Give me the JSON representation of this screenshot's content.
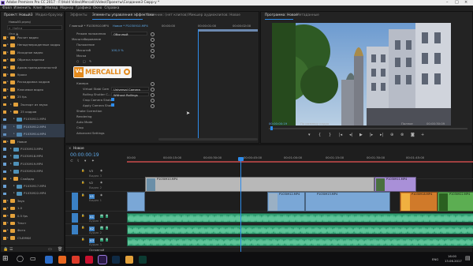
{
  "window": {
    "title": "Adobe Premiere Pro CC 2017 - F:\\Hold Video\\Mercalli\\Video\\Проекты\\Создание3 Сюрр-у *"
  },
  "menu": [
    "Файл",
    "Изменить",
    "Клип",
    "Эпизод",
    "Маркер",
    "Графика",
    "Окно",
    "Справка"
  ],
  "project": {
    "tabs": [
      "Проект: Новый3",
      "Медиа-браузер"
    ],
    "path": "Новый3.prproj",
    "search_placeholder": "Найти",
    "items": [
      "Расчет видео",
      "Неподтвержденные кадры",
      "Исходное видео",
      "Обрезка нарезки",
      "Архив принадлежностей",
      "Уроки",
      "Раскадровка кадров",
      "Ключевое видео",
      "25 fps",
      "Экспорт из звука",
      "25 кадров",
      "P1030911.MP4",
      "P1030912.MP4",
      "P1030914.MP4",
      "Новое",
      "P1030913.MP4",
      "P1030918.MP4",
      "P1030919.MP4",
      "P1030920.MP4",
      "Слайдер",
      "P1030917.MP4",
      "P1030922.MP4",
      "Звук",
      "1.0",
      "0.5 fps",
      "Текст",
      "Фото",
      "СЪЕМКИ"
    ]
  },
  "effects": {
    "tabs": [
      "Эффекты",
      "Элементы управления эффектами",
      "Источник: (нет клипов)",
      "Микшер аудиоклипов: Новое"
    ],
    "source_label": "Главный * P1030910.MP4",
    "clip_label": "Новое * P1030910.MP4",
    "time_start": "00:00:00",
    "time_mid": "00:00:01:00",
    "time_end": "00:00:02:00",
    "rows": [
      "Режим наложения",
      "Масштабирование",
      "Положение",
      "Масштаб",
      "Маска"
    ],
    "blend_value": "Обычный",
    "scale_value": "100,0 %",
    "logo_prefix": "V4",
    "logo_text": "MERCALLI",
    "mercalli_rows": [
      "Камера",
      "Virtual Stabi Cam",
      "Rolling Shutter C...",
      "Crop Camera Shake",
      "Apply Camera Shake",
      "Shake Correction",
      "Rendering",
      "Auto Mode",
      "Crop",
      "Advanced Settings"
    ],
    "camera_value": "Universal Camera",
    "rolling_value": "Without Rollings"
  },
  "program": {
    "tabs": [
      "Программа: Новое",
      "Метаданные"
    ],
    "timecode": "00:00:00:19",
    "fit": "По размеру кадра",
    "quality": "Полное",
    "duration": "00:00:30:09"
  },
  "timeline": {
    "tab": "Новое",
    "timecode": "00:00:00:19",
    "ruler": [
      "00:00",
      "00:00:15:00",
      "00:00:30:00",
      "00:00:45:00",
      "00:01:00:00",
      "00:01:15:00",
      "00:01:30:00",
      "00:01:45:00"
    ],
    "video_tracks": [
      "V3",
      "V2",
      "V1"
    ],
    "audio_tracks": [
      "A1",
      "A2",
      "A3"
    ],
    "track_names": [
      "Видео 3",
      "Видео 2",
      "Видео 1",
      "Аудио 1",
      "Аудио 2",
      "Аудио 3"
    ],
    "clip_labels": [
      "P1030910.MP4",
      "P1030911.MP4",
      "P1030912.MP4",
      "P1030913.MP4",
      "P1030918.MP4",
      "P1030922.MP4"
    ],
    "master": "Основной"
  },
  "taskbar": {
    "time": "16:00",
    "date": "13.06.2017",
    "lang": "ENG"
  },
  "colors": {
    "accent": "#2d8ceb",
    "folder": "#e3a13b",
    "clip_blue": "#7aa7d6",
    "audio_green": "#2f9c71"
  }
}
